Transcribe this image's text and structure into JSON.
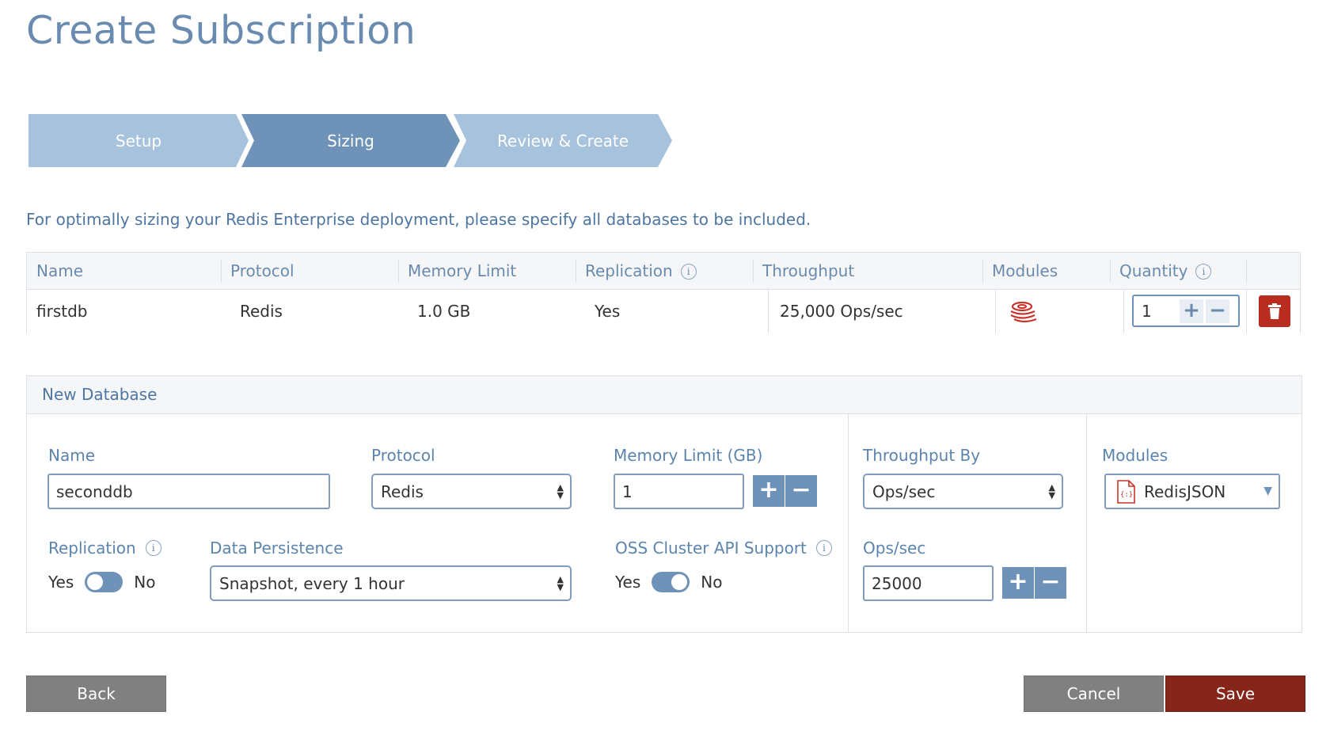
{
  "page": {
    "title": "Create Subscription"
  },
  "steps": [
    {
      "label": "Setup"
    },
    {
      "label": "Sizing"
    },
    {
      "label": "Review & Create"
    }
  ],
  "intro_text": "For optimally sizing your Redis Enterprise deployment, please specify all databases to be included.",
  "table": {
    "headers": {
      "name": "Name",
      "protocol": "Protocol",
      "memory": "Memory Limit",
      "replication": "Replication",
      "throughput": "Throughput",
      "modules": "Modules",
      "quantity": "Quantity"
    },
    "rows": [
      {
        "name": "firstdb",
        "protocol": "Redis",
        "memory": "1.0 GB",
        "replication": "Yes",
        "throughput": "25,000 Ops/sec",
        "modules_icon": "redis-stack-icon",
        "quantity": "1"
      }
    ]
  },
  "new_db": {
    "title": "New Database",
    "name_label": "Name",
    "name_value": "seconddb",
    "protocol_label": "Protocol",
    "protocol_value": "Redis",
    "memory_label": "Memory Limit (GB)",
    "memory_value": "1",
    "throughput_by_label": "Throughput By",
    "throughput_by_value": "Ops/sec",
    "modules_label": "Modules",
    "modules_value": "RedisJSON",
    "replication_label": "Replication",
    "replication_yes": "Yes",
    "replication_no": "No",
    "persistence_label": "Data Persistence",
    "persistence_value": "Snapshot, every 1 hour",
    "oss_label": "OSS Cluster API Support",
    "oss_yes": "Yes",
    "oss_no": "No",
    "ops_label": "Ops/sec",
    "ops_value": "25000"
  },
  "buttons": {
    "back": "Back",
    "cancel": "Cancel",
    "save": "Save"
  },
  "colors": {
    "accent": "#6f93b8",
    "step_light": "#a6c2dc",
    "danger": "#b82d20",
    "save": "#86261b",
    "neutral_button": "#808080"
  }
}
